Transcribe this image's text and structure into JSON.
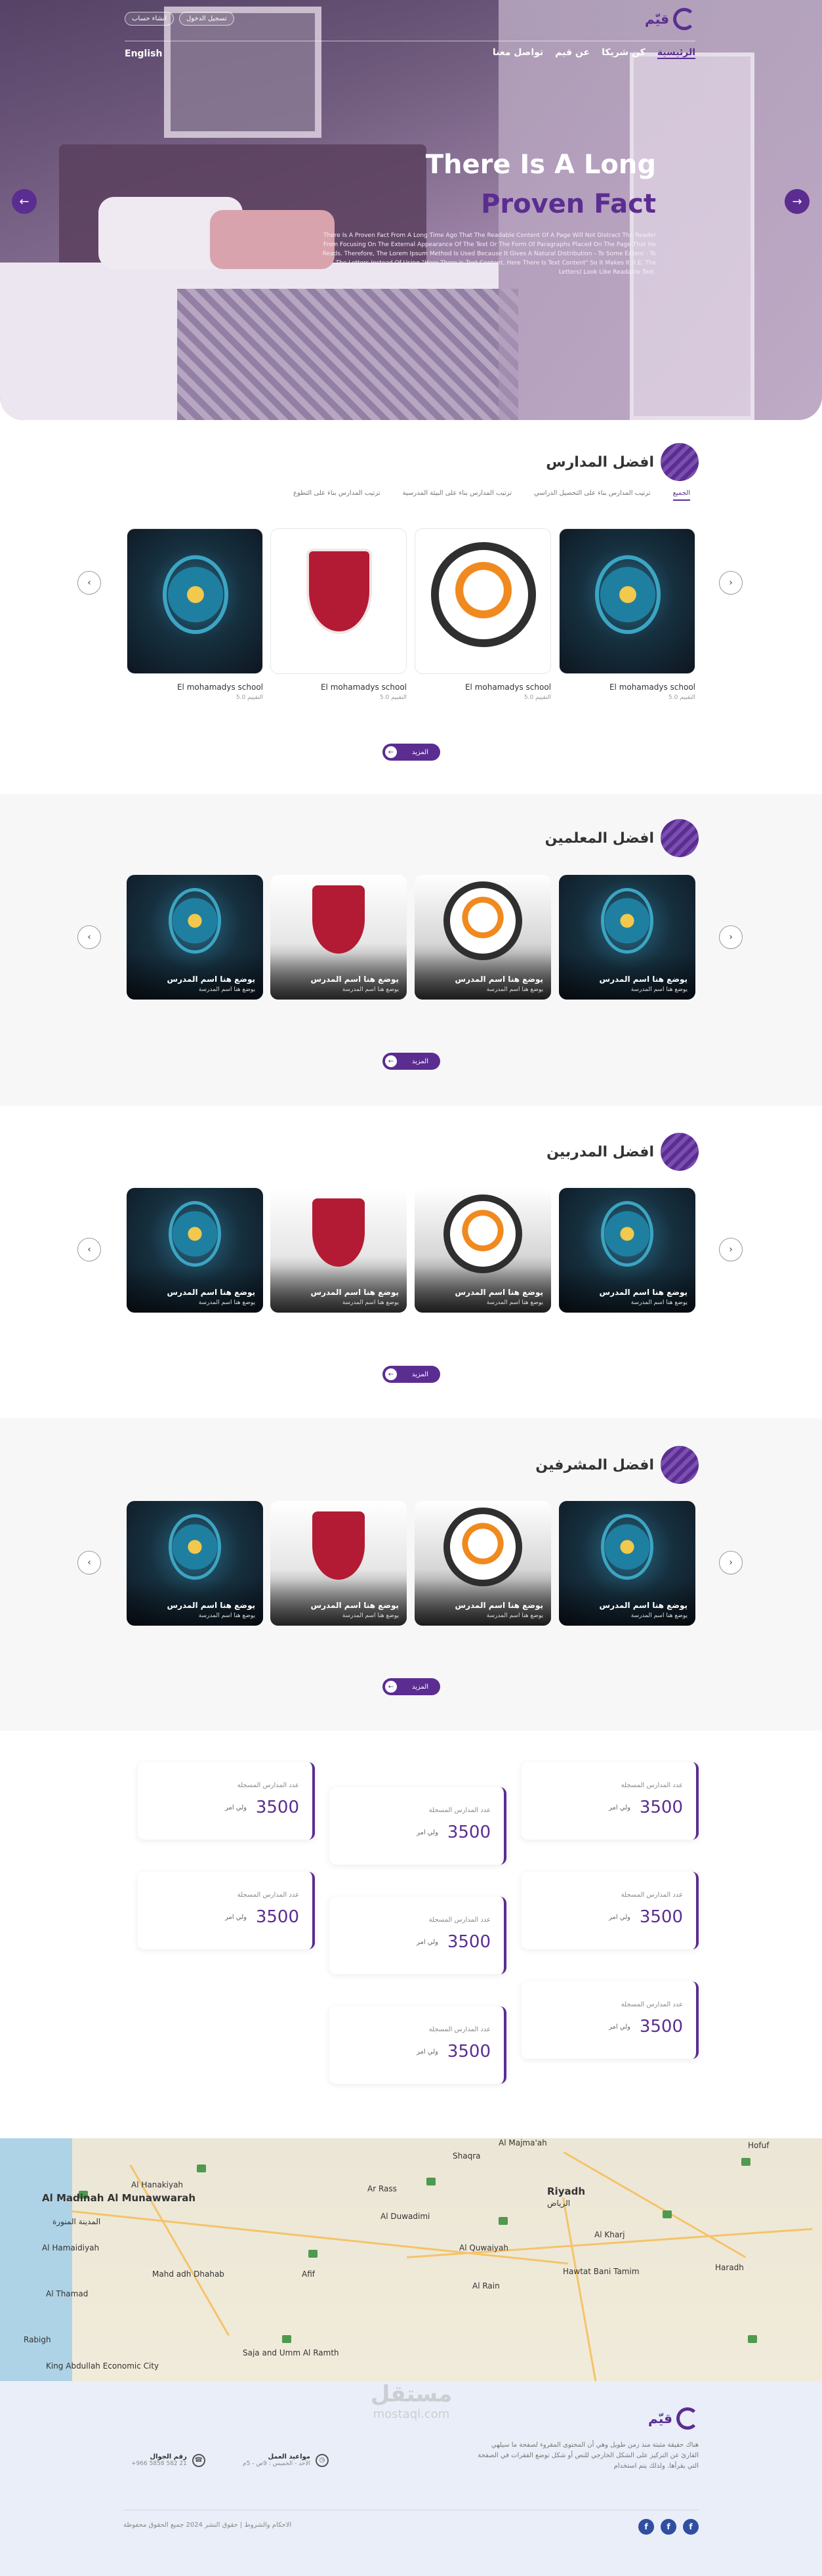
{
  "brand": {
    "name": "قيّم",
    "color": "#5b2d91"
  },
  "header": {
    "top_buttons": [
      "تسجيل الدخول",
      "انشاء حساب"
    ],
    "nav": [
      "الرئيسية",
      "كن شريكا",
      "عن قيم",
      "تواصل معنا"
    ],
    "language": "English"
  },
  "hero": {
    "title_line1": "There Is A Long",
    "title_line2": "Proven Fact",
    "description": "There Is A Proven Fact From A Long Time Ago That The Readable Content Of A Page Will Not Distract The Reader From Focusing On The External Appearance Of The Text Or The Form Of Paragraphs Placed On The Page That He Reads. Therefore, The Lorem Ipsum Method Is Used Because It Gives A Natural Distribution - To Some Extent - To The Letters Instead Of Using \"Here There Is Text Content, Here There Is Text Content\" So It Makes It (I.E. The Letters) Look Like Readable Text."
  },
  "schools": {
    "title": "افضل المدارس",
    "tabs": [
      "الجميع",
      "ترتيب المدارس بناء على التحصيل الدراسي",
      "ترتيب المدارس بناء على البيئة المدرسية",
      "ترتيب المدارس بناء على التطوع"
    ],
    "cards": [
      {
        "name": "El mohamadys school",
        "rating": "التقييم 5.0"
      },
      {
        "name": "El mohamadys school",
        "rating": "5.0 التقييم"
      },
      {
        "name": "El mohamadys school",
        "rating": "5.0 التقييم"
      },
      {
        "name": "El mohamadys school",
        "rating": "5.0 التقييم"
      }
    ],
    "more": "المزيد"
  },
  "teachers": {
    "title": "افضل المعلمين",
    "card_name": "يوضع هنا اسم المدرس",
    "card_sub": "يوضع هنا اسم المدرسة",
    "more": "المزيد"
  },
  "trainers": {
    "title": "افضل المدربين",
    "card_name": "يوضع هنا اسم المدرس",
    "card_sub": "يوضع هنا اسم المدرسة",
    "more": "المزيد"
  },
  "supervisors": {
    "title": "افضل المشرفين",
    "card_name": "يوضع هنا اسم المدرس",
    "card_sub": "يوضع هنا اسم المدرسة",
    "more": "المزيد"
  },
  "stats": {
    "label": "عدد المدارس المسجلة",
    "value": "3500",
    "unit": "ولي امر"
  },
  "map": {
    "labels": [
      "Al Madinah Al Munawwarah",
      "المدينة المنورة",
      "Al Hanakiyah",
      "Al Hamaidiyah",
      "Riyadh",
      "الرياض",
      "Al Duwadimi",
      "Al Quwaiyah",
      "Al Kharj",
      "Hofuf",
      "Ar Rass",
      "Mahd adh Dhahab",
      "Afif",
      "Rabigh",
      "Haradh",
      "Hawtat Bani Tamim",
      "Shaqra",
      "Al Majma'ah",
      "Al Thamad",
      "Saja and Umm Al Ramth",
      "King Abdullah Economic City",
      "Al Rain"
    ]
  },
  "footer": {
    "description": "هناك حقيقة مثبتة منذ زمن طويل وهي أن المحتوى المقروء لصفحة ما سيلهي القارئ عن التركيز على الشكل الخارجي للنص أو شكل توضع الفقرات في الصفحة التي يقرأها. ولذلك يتم استخدام",
    "hours_title": "مواعيد العمل",
    "hours_value": "الأحد - الخميس : 9ص - 5م",
    "phone_title": "رقم الجوال",
    "phone_value": "+966 5858 582 21",
    "copyright": "الاحكام والشروط | حقوق النشر 2024 جميع الحقوق محفوظة",
    "social": [
      "f",
      "f",
      "f"
    ]
  },
  "watermark": {
    "ar": "مستقل",
    "en": "mostaql.com"
  }
}
